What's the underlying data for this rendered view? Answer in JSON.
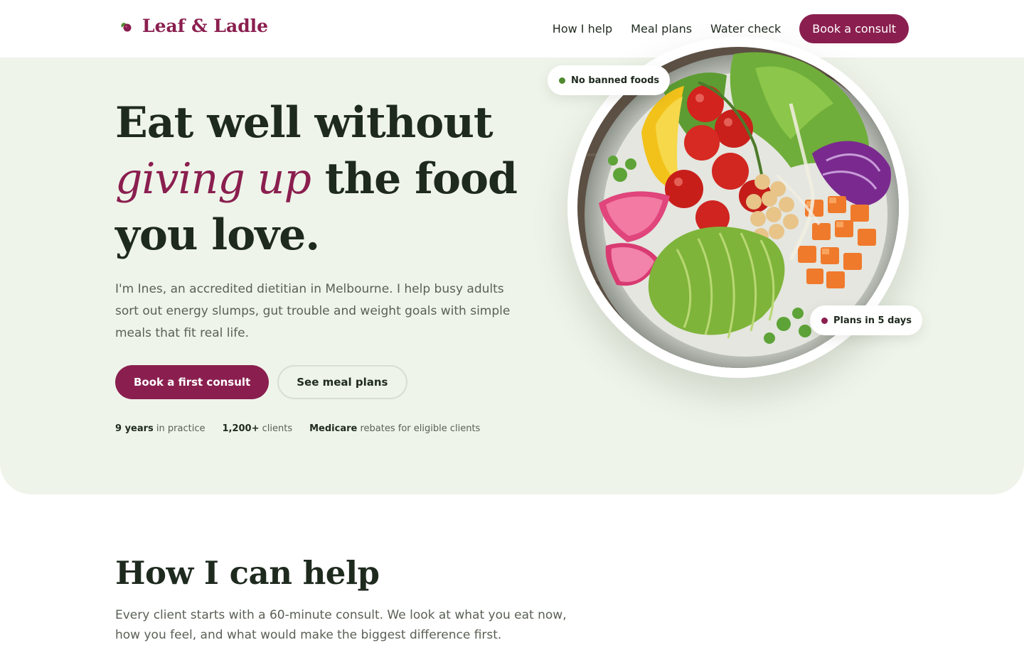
{
  "brand": {
    "name": "Leaf & Ladle",
    "icon": "leaf-berry-icon"
  },
  "nav": {
    "links": [
      "How I help",
      "Meal plans",
      "Water check"
    ],
    "cta_label": "Book a consult"
  },
  "hero": {
    "title_part1": "Eat well without",
    "title_accent": "giving up",
    "title_part2": " the food",
    "title_part3": "you love.",
    "description": "I'm Ines, an accredited dietitian in Melbourne. I help busy adults sort out energy slumps, gut trouble and weight goals with simple meals that fit real life.",
    "primary_button": "Book a first consult",
    "secondary_button": "See meal plans",
    "stats": [
      {
        "value": "9 years",
        "label": " in practice"
      },
      {
        "value": "1,200+",
        "label": " clients"
      },
      {
        "value": "Medicare",
        "label": " rebates for eligible clients"
      }
    ],
    "badges": [
      {
        "label": "No banned foods",
        "dot_color": "#4f8a2e"
      },
      {
        "label": "Plans in 5 days",
        "dot_color": "#8a1f4f"
      }
    ],
    "image": "salad-bowl"
  },
  "section": {
    "title": "How I can help",
    "description": "Every client starts with a 60-minute consult. We look at what you eat now, how you feel, and what would make the biggest difference first."
  },
  "colors": {
    "accent": "#8a1f4f",
    "hero_bg": "#eff4ea",
    "text": "#1f2a1f",
    "muted": "#5a6055"
  }
}
